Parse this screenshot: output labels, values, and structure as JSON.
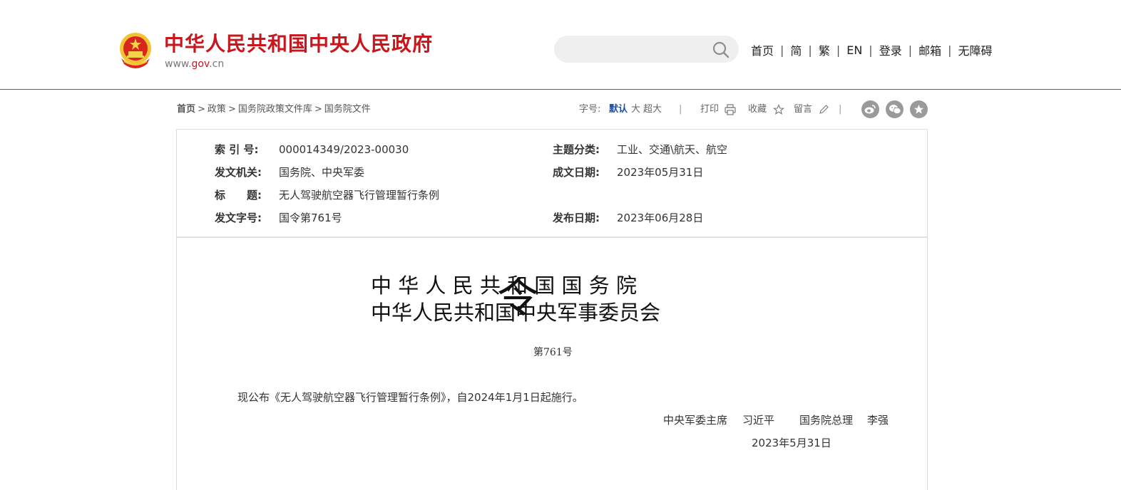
{
  "header": {
    "site_title": "中华人民共和国中央人民政府",
    "site_url_prefix": "www.",
    "site_url_domain": "gov",
    "site_url_suffix": ".cn",
    "search_placeholder": "",
    "nav": [
      "首页",
      "简",
      "繁",
      "EN",
      "登录",
      "邮箱",
      "无障碍"
    ],
    "nav_separator": "|"
  },
  "breadcrumb": {
    "home": "首页",
    "items": [
      "政策",
      "国务院政策文件库",
      "国务院文件"
    ],
    "separator": ">"
  },
  "toolbar": {
    "font_size_label": "字号:",
    "font_default": "默认",
    "font_large": "大",
    "font_xlarge": "超大",
    "divider": "|",
    "print": "打印",
    "favorite": "收藏",
    "comment": "留言",
    "share_icons": [
      "weibo-icon",
      "wechat-icon",
      "star-icon"
    ]
  },
  "meta": {
    "index_label": "索 引 号:",
    "index_value": "000014349/2023-00030",
    "topic_label": "主题分类:",
    "topic_value": "工业、交通\\航天、航空",
    "issuer_label": "发文机关:",
    "issuer_value": "国务院、中央军委",
    "written_date_label": "成文日期:",
    "written_date_value": "2023年05月31日",
    "title_label": "标　　题:",
    "title_value": "无人驾驶航空器飞行管理暂行条例",
    "doc_no_label": "发文字号:",
    "doc_no_value": "国令第761号",
    "publish_date_label": "发布日期:",
    "publish_date_value": "2023年06月28日"
  },
  "document": {
    "line1": "中 华 人 民 共 和 国 国 务 院",
    "line2": "中华人民共和国中央军事委员会",
    "ling": "令",
    "number": "第761号",
    "body": "现公布《无人驾驶航空器飞行管理暂行条例》，自2024年1月1日起施行。",
    "signer1_title": "中央军委主席",
    "signer1_name": "习近平",
    "signer2_title": "国务院总理",
    "signer2_name": "李强",
    "date": "2023年5月31日"
  },
  "colors": {
    "brand_red": "#c8161d",
    "accent_blue": "#1f4e9d",
    "header_rule": "#3a64ad"
  }
}
